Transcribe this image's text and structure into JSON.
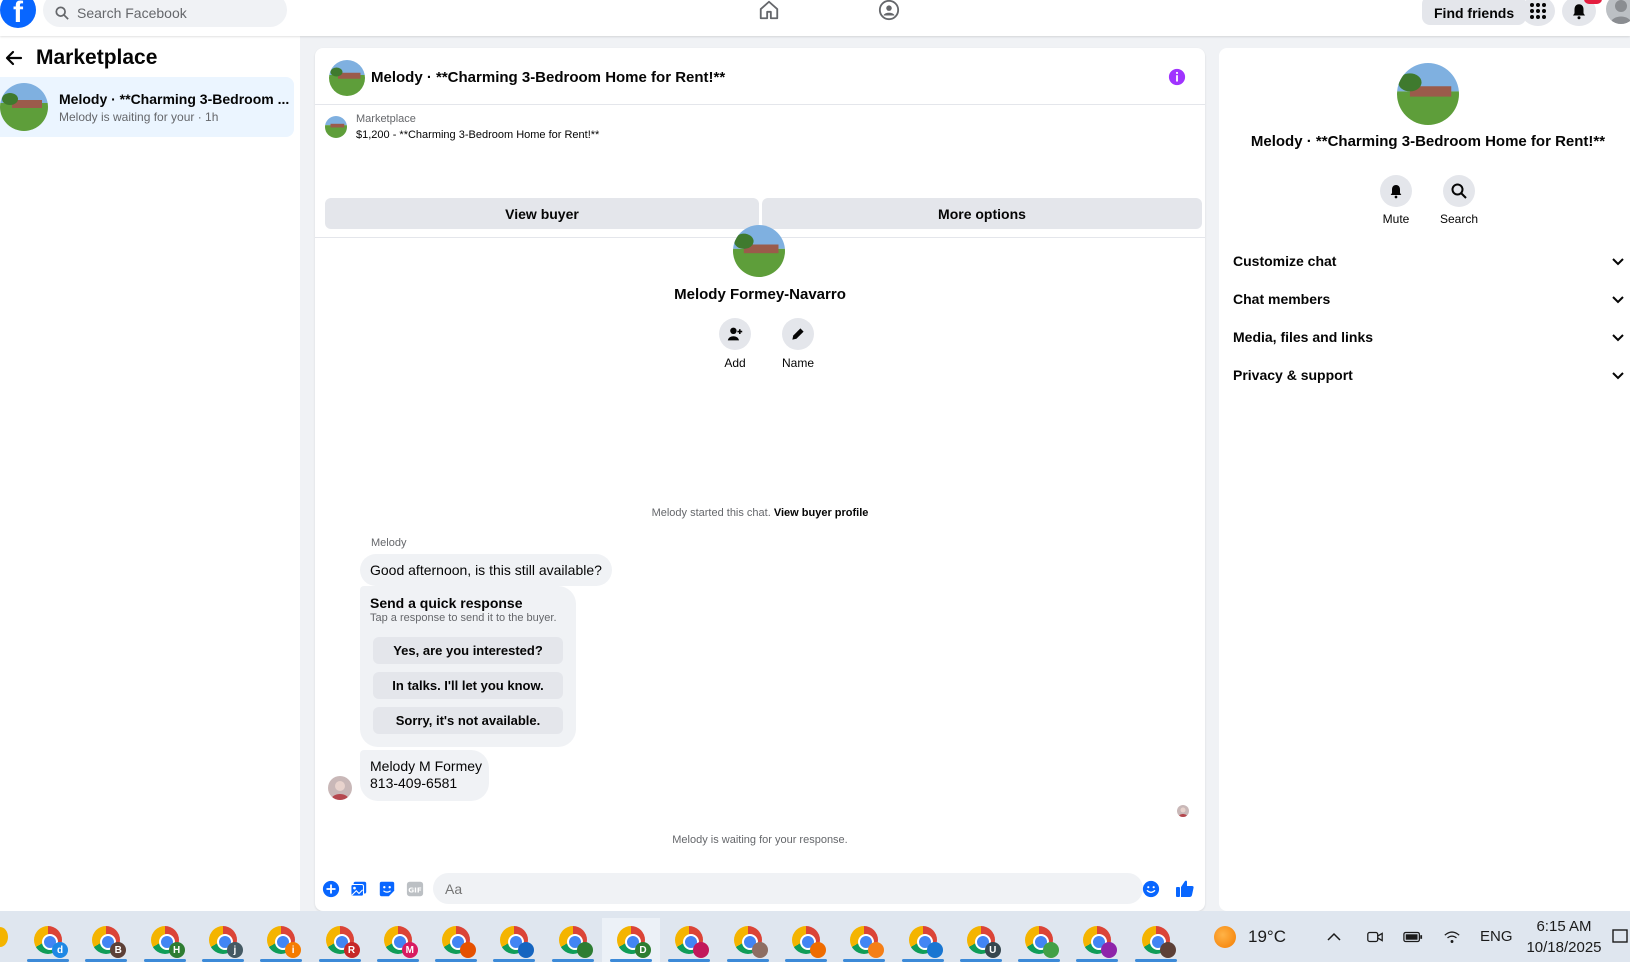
{
  "topbar": {
    "search_placeholder": "Search Facebook",
    "find_friends": "Find friends"
  },
  "sidebar": {
    "title": "Marketplace",
    "conversation": {
      "name": "Melody · **Charming 3-Bedroom ...",
      "preview": "Melody is waiting for your · 1h"
    }
  },
  "chat": {
    "title": "Melody · **Charming 3-Bedroom Home for Rent!**",
    "listing": {
      "label": "Marketplace",
      "price_title": "$1,200 - **Charming 3-Bedroom Home for Rent!**",
      "view_buyer": "View buyer",
      "more_options": "More options"
    },
    "profile": {
      "name": "Melody Formey-Navarro",
      "add_label": "Add",
      "name_label": "Name"
    },
    "started_text": "Melody started this chat.",
    "view_buyer_profile": "View buyer profile",
    "sender": "Melody",
    "message1": "Good afternoon, is this still available?",
    "quick": {
      "title": "Send a quick response",
      "subtitle": "Tap a response to send it to the buyer.",
      "options": [
        "Yes, are you interested?",
        "In talks. I'll let you know.",
        "Sorry, it's not available."
      ]
    },
    "message2": {
      "line1": "Melody M Formey",
      "line2": "813-409-6581"
    },
    "waiting": "Melody is waiting for your response.",
    "composer_placeholder": "Aa"
  },
  "right_panel": {
    "title": "Melody · **Charming 3-Bedroom Home for Rent!**",
    "mute": "Mute",
    "search": "Search",
    "sections": [
      "Customize chat",
      "Chat members",
      "Media, files and links",
      "Privacy & support"
    ]
  },
  "taskbar": {
    "apps": [
      "d",
      "B",
      "H",
      "j",
      "i",
      "R",
      "M",
      "",
      "",
      "",
      "D",
      "",
      "",
      "",
      "",
      "",
      "U",
      "",
      "",
      ""
    ],
    "temperature": "19°C",
    "language": "ENG",
    "time": "6:15 AM",
    "date": "10/18/2025"
  },
  "colors": {
    "brand": "#0866ff",
    "info": "#a033ff",
    "selected": "#ebf5ff"
  }
}
